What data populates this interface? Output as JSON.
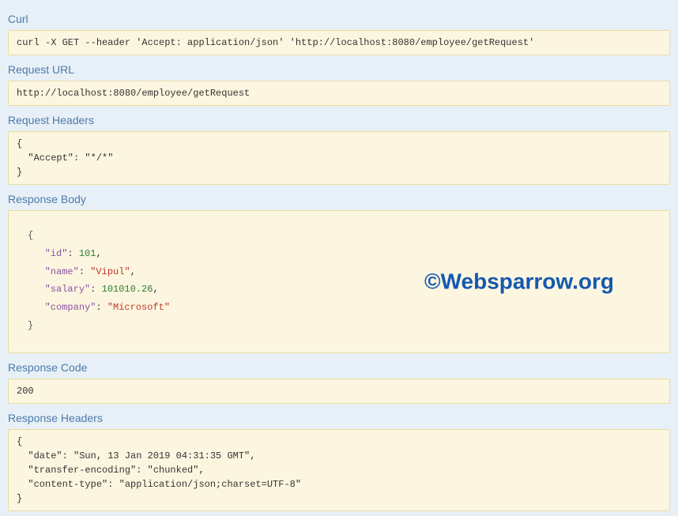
{
  "sections": {
    "curl": {
      "heading": "Curl",
      "content": "curl -X GET --header 'Accept: application/json' 'http://localhost:8080/employee/getRequest'"
    },
    "request_url": {
      "heading": "Request URL",
      "content": "http://localhost:8080/employee/getRequest"
    },
    "request_headers": {
      "heading": "Request Headers",
      "content": "{\n  \"Accept\": \"*/*\"\n}"
    },
    "response_body": {
      "heading": "Response Body",
      "json": {
        "id_key": "\"id\"",
        "id_val": "101",
        "name_key": "\"name\"",
        "name_val": "\"Vipul\"",
        "salary_key": "\"salary\"",
        "salary_val": "101010.26",
        "company_key": "\"company\"",
        "company_val": "\"Microsoft\""
      }
    },
    "response_code": {
      "heading": "Response Code",
      "content": "200"
    },
    "response_headers": {
      "heading": "Response Headers",
      "content": "{\n  \"date\": \"Sun, 13 Jan 2019 04:31:35 GMT\",\n  \"transfer-encoding\": \"chunked\",\n  \"content-type\": \"application/json;charset=UTF-8\"\n}"
    }
  },
  "watermark": "©Websparrow.org"
}
